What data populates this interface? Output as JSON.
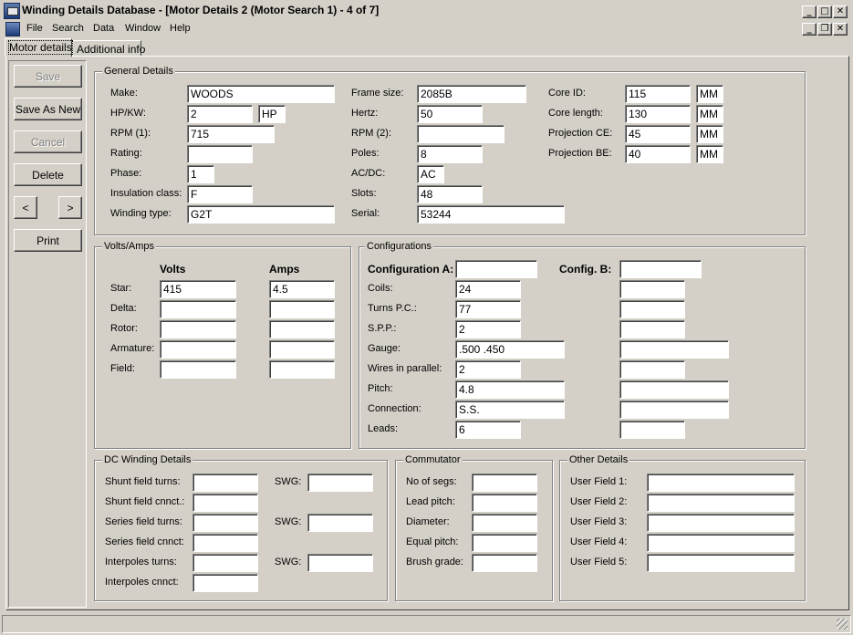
{
  "window": {
    "title": "Winding Details Database - [Motor Details 2 (Motor Search 1) - 4 of 7]"
  },
  "menu": [
    "File",
    "Search",
    "Data",
    "Window",
    "Help"
  ],
  "tabs": [
    "Motor details",
    "Additional info"
  ],
  "buttons": {
    "save": "Save",
    "save_as_new": "Save As New",
    "cancel": "Cancel",
    "delete": "Delete",
    "prev": "<",
    "next": ">",
    "print": "Print"
  },
  "caption_glyphs": {
    "minimize": "_",
    "maximize": "□",
    "restore": "❐",
    "close": "✕"
  },
  "general": {
    "title": "General Details",
    "make": {
      "label": "Make:",
      "value": "WOODS"
    },
    "hpkw": {
      "label": "HP/KW:",
      "value": "2",
      "unit": "HP"
    },
    "rpm1": {
      "label": "RPM (1):",
      "value": "715"
    },
    "rating": {
      "label": "Rating:",
      "value": ""
    },
    "phase": {
      "label": "Phase:",
      "value": "1"
    },
    "insulation": {
      "label": "Insulation class:",
      "value": "F"
    },
    "winding_type": {
      "label": "Winding type:",
      "value": "G2T"
    },
    "frame_size": {
      "label": "Frame size:",
      "value": "2085B"
    },
    "hertz": {
      "label": "Hertz:",
      "value": "50"
    },
    "rpm2": {
      "label": "RPM (2):",
      "value": ""
    },
    "poles": {
      "label": "Poles:",
      "value": "8"
    },
    "acdc": {
      "label": "AC/DC:",
      "value": "AC"
    },
    "slots": {
      "label": "Slots:",
      "value": "48"
    },
    "serial": {
      "label": "Serial:",
      "value": "53244"
    },
    "core_id": {
      "label": "Core ID:",
      "value": "115",
      "unit": "MM"
    },
    "core_length": {
      "label": "Core length:",
      "value": "130",
      "unit": "MM"
    },
    "projection_ce": {
      "label": "Projection CE:",
      "value": "45",
      "unit": "MM"
    },
    "projection_be": {
      "label": "Projection BE:",
      "value": "40",
      "unit": "MM"
    }
  },
  "volts_amps": {
    "title": "Volts/Amps",
    "col_volts": "Volts",
    "col_amps": "Amps",
    "rows": [
      {
        "label": "Star:",
        "volts": "415",
        "amps": "4.5"
      },
      {
        "label": "Delta:",
        "volts": "",
        "amps": ""
      },
      {
        "label": "Rotor:",
        "volts": "",
        "amps": ""
      },
      {
        "label": "Armature:",
        "volts": "",
        "amps": ""
      },
      {
        "label": "Field:",
        "volts": "",
        "amps": ""
      }
    ]
  },
  "configurations": {
    "title": "Configurations",
    "config_a_label": "Configuration A:",
    "config_a_value": "",
    "config_b_label": "Config. B:",
    "config_b_value": "",
    "rows": [
      {
        "label": "Coils:",
        "a": "24",
        "b": ""
      },
      {
        "label": "Turns P.C.:",
        "a": "77",
        "b": ""
      },
      {
        "label": "S.P.P.:",
        "a": "2",
        "b": ""
      },
      {
        "label": "Gauge:",
        "a": ".500 .450",
        "b": ""
      },
      {
        "label": "Wires in parallel:",
        "a": "2",
        "b": ""
      },
      {
        "label": "Pitch:",
        "a": "4.8",
        "b": ""
      },
      {
        "label": "Connection:",
        "a": "S.S.",
        "b": ""
      },
      {
        "label": "Leads:",
        "a": "6",
        "b": ""
      }
    ]
  },
  "dc_winding": {
    "title": "DC Winding Details",
    "swg_label": "SWG:",
    "rows": [
      {
        "label": "Shunt field turns:",
        "value": "",
        "swg": ""
      },
      {
        "label": "Shunt field cnnct.:",
        "value": ""
      },
      {
        "label": "Series field turns:",
        "value": "",
        "swg": ""
      },
      {
        "label": "Series field cnnct:",
        "value": ""
      },
      {
        "label": "Interpoles turns:",
        "value": "",
        "swg": ""
      },
      {
        "label": "Interpoles cnnct:",
        "value": ""
      }
    ]
  },
  "commutator": {
    "title": "Commutator",
    "rows": [
      {
        "label": "No of segs:",
        "value": ""
      },
      {
        "label": "Lead pitch:",
        "value": ""
      },
      {
        "label": "Diameter:",
        "value": ""
      },
      {
        "label": "Equal pitch:",
        "value": ""
      },
      {
        "label": "Brush grade:",
        "value": ""
      }
    ]
  },
  "other": {
    "title": "Other Details",
    "rows": [
      {
        "label": "User Field 1:",
        "value": ""
      },
      {
        "label": "User Field 2:",
        "value": ""
      },
      {
        "label": "User Field 3:",
        "value": ""
      },
      {
        "label": "User Field 4:",
        "value": ""
      },
      {
        "label": "User Field 5:",
        "value": ""
      }
    ]
  }
}
